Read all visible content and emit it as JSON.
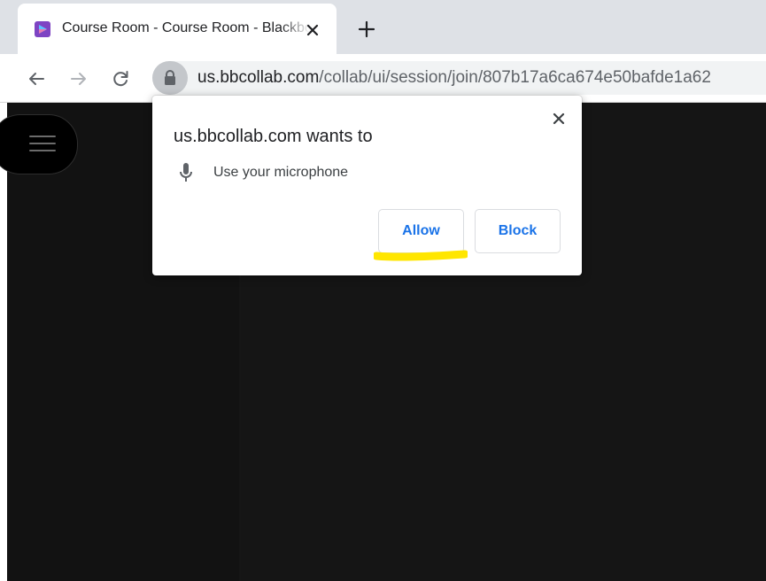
{
  "tab": {
    "title": "Course Room - Course Room - Blackboard Collaborate"
  },
  "omnibox": {
    "url_host": "us.bbcollab.com",
    "url_path": "/collab/ui/session/join/807b17a6ca674e50bafde1a62"
  },
  "dialog": {
    "title": "us.bbcollab.com wants to",
    "permission": "Use your microphone",
    "allow_label": "Allow",
    "block_label": "Block"
  },
  "icons": {
    "favicon": "blackboard-collaborate-icon",
    "close": "close-icon",
    "new_tab": "plus-icon",
    "back": "arrow-left-icon",
    "forward": "arrow-right-icon",
    "reload": "reload-icon",
    "lock": "lock-icon",
    "microphone": "microphone-icon",
    "menu": "hamburger-menu-icon"
  },
  "colors": {
    "accent_blue": "#1a73e8",
    "highlight_yellow": "#ffe600",
    "favicon_purple": "#7e44c3",
    "page_background": "#151515"
  }
}
